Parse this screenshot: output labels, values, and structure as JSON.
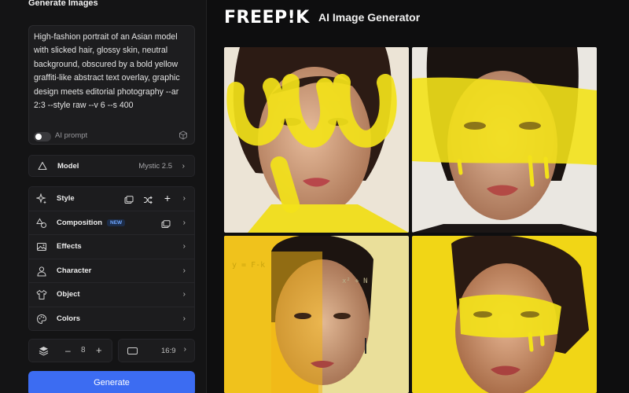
{
  "sidebar": {
    "title": "Generate Images",
    "prompt": "High-fashion portrait of an Asian model with slicked hair, glossy skin, neutral background, obscured by a bold yellow graffiti-like abstract text overlay, graphic design meets editorial photography --ar 2:3 --style raw --v 6 --s 400",
    "ai_prompt_label": "AI prompt",
    "model": {
      "label": "Model",
      "value": "Mystic 2.5"
    },
    "options": [
      {
        "label": "Style"
      },
      {
        "label": "Composition",
        "badge": "NEW"
      },
      {
        "label": "Effects"
      },
      {
        "label": "Character"
      },
      {
        "label": "Object"
      },
      {
        "label": "Colors"
      }
    ],
    "count": {
      "minus": "–",
      "value": "8",
      "plus": "+"
    },
    "aspect": {
      "value": "16:9"
    },
    "generate_label": "Generate"
  },
  "header": {
    "brand": "FREEP!K",
    "subtitle": "AI Image Generator"
  },
  "colors": {
    "accent": "#3c6cf2",
    "paint_yellow": "#f3e21a"
  },
  "gallery": {
    "images": [
      {
        "name": "portrait-yellow-scribble"
      },
      {
        "name": "portrait-yellow-brushstroke"
      },
      {
        "name": "portrait-yellow-split"
      },
      {
        "name": "portrait-yellow-smear"
      }
    ]
  }
}
